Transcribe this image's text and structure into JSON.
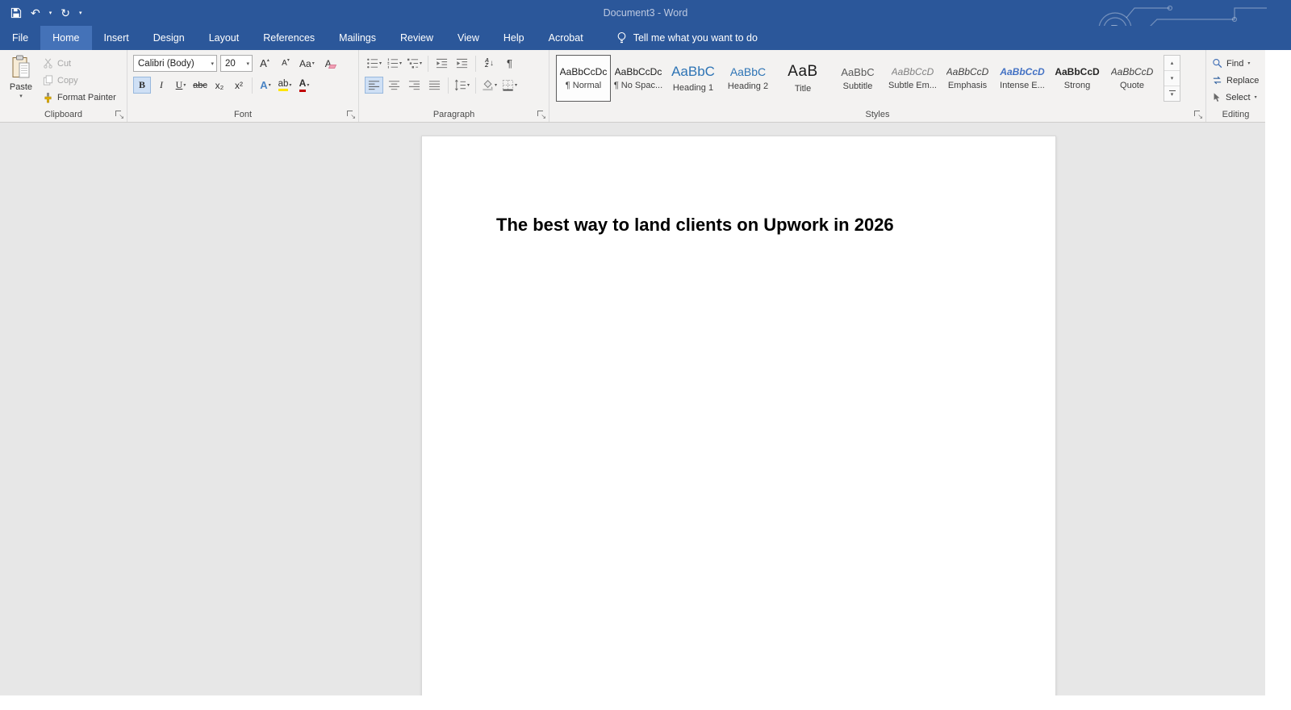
{
  "colors": {
    "titlebar": "#2b579a",
    "active_tab": "#4472b8",
    "ribbon_bg": "#f3f2f1",
    "document_bg": "#e7e7e7",
    "page_bg": "#ffffff",
    "highlight_yellow": "#ffe500",
    "font_color_red": "#c00000",
    "heading_blue": "#2e74b5"
  },
  "icons": {
    "caret": "▾",
    "undo": "↶",
    "redo": "↻",
    "qat_more": "▾",
    "pilcrow": "¶",
    "sort_a": "A",
    "sort_z": "Z",
    "sort_arrow": "↓",
    "grow_arrow": "▴",
    "shrink_arrow": "▾",
    "scroll_up": "▴",
    "scroll_down": "▾"
  },
  "titlebar": {
    "title": "Document3  -  Word"
  },
  "tabs": [
    {
      "label": "File",
      "active": false
    },
    {
      "label": "Home",
      "active": true
    },
    {
      "label": "Insert",
      "active": false
    },
    {
      "label": "Design",
      "active": false
    },
    {
      "label": "Layout",
      "active": false
    },
    {
      "label": "References",
      "active": false
    },
    {
      "label": "Mailings",
      "active": false
    },
    {
      "label": "Review",
      "active": false
    },
    {
      "label": "View",
      "active": false
    },
    {
      "label": "Help",
      "active": false
    },
    {
      "label": "Acrobat",
      "active": false
    }
  ],
  "tellme": {
    "label": "Tell me what you want to do"
  },
  "ribbon": {
    "groups": {
      "clipboard": {
        "label": "Clipboard",
        "paste_label": "Paste",
        "cut_label": "Cut",
        "copy_label": "Copy",
        "format_painter_label": "Format Painter"
      },
      "font": {
        "label": "Font",
        "font_name_value": "Calibri (Body)",
        "font_size_value": "20",
        "grow_font_label": "A",
        "shrink_font_label": "A",
        "change_case_label": "Aa",
        "clear_formatting_label": "A",
        "bold_label": "B",
        "italic_label": "I",
        "underline_label": "U",
        "strikethrough_label": "abc",
        "subscript_label": "x₂",
        "superscript_label": "x²",
        "text_effects_label": "A",
        "highlight_label": "ab",
        "font_color_label": "A"
      },
      "paragraph": {
        "label": "Paragraph"
      },
      "styles": {
        "label": "Styles",
        "items": [
          {
            "preview": "AaBbCcDc",
            "name": "¶ Normal",
            "selected": true
          },
          {
            "preview": "AaBbCcDc",
            "name": "¶ No Spac...",
            "selected": false
          },
          {
            "preview": "AaBbC",
            "name": "Heading 1",
            "selected": false
          },
          {
            "preview": "AaBbC",
            "name": "Heading 2",
            "selected": false
          },
          {
            "preview": "AaB",
            "name": "Title",
            "selected": false
          },
          {
            "preview": "AaBbC",
            "name": "Subtitle",
            "selected": false
          },
          {
            "preview": "AaBbCcD",
            "name": "Subtle Em...",
            "selected": false
          },
          {
            "preview": "AaBbCcD",
            "name": "Emphasis",
            "selected": false
          },
          {
            "preview": "AaBbCcD",
            "name": "Intense E...",
            "selected": false
          },
          {
            "preview": "AaBbCcD",
            "name": "Strong",
            "selected": false
          },
          {
            "preview": "AaBbCcD",
            "name": "Quote",
            "selected": false
          }
        ]
      },
      "editing": {
        "label": "Editing",
        "find_label": "Find",
        "replace_label": "Replace",
        "select_label": "Select"
      }
    }
  },
  "document": {
    "heading": "The best way to land clients on Upwork in 2026"
  }
}
